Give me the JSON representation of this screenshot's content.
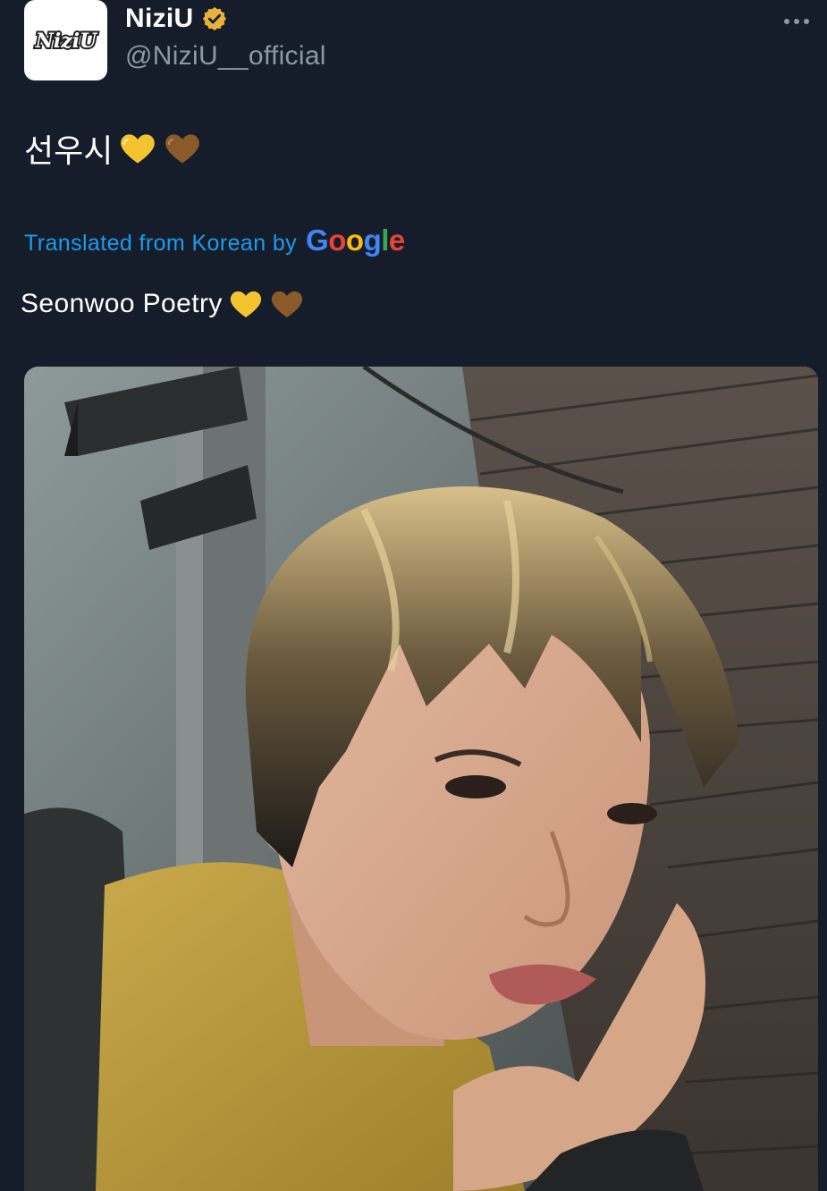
{
  "author": {
    "display_name": "NiziU",
    "handle": "@NiziU__official",
    "verified_color": "#e8b13b",
    "avatar_logo_text": "NiziU"
  },
  "tweet": {
    "text": "선우시",
    "hearts": [
      "yellow-heart",
      "brown-heart"
    ]
  },
  "translation": {
    "label": "Translated from Korean by",
    "provider": "Google",
    "text": "Seonwoo Poetry"
  },
  "colors": {
    "background": "#151d2a",
    "link": "#1d9bf0",
    "secondary_text": "#8b98a5",
    "yellow_heart": "#f4c430",
    "brown_heart": "#8a5a2b"
  },
  "media": {
    "type": "photo",
    "subject": "selfie-photo"
  }
}
